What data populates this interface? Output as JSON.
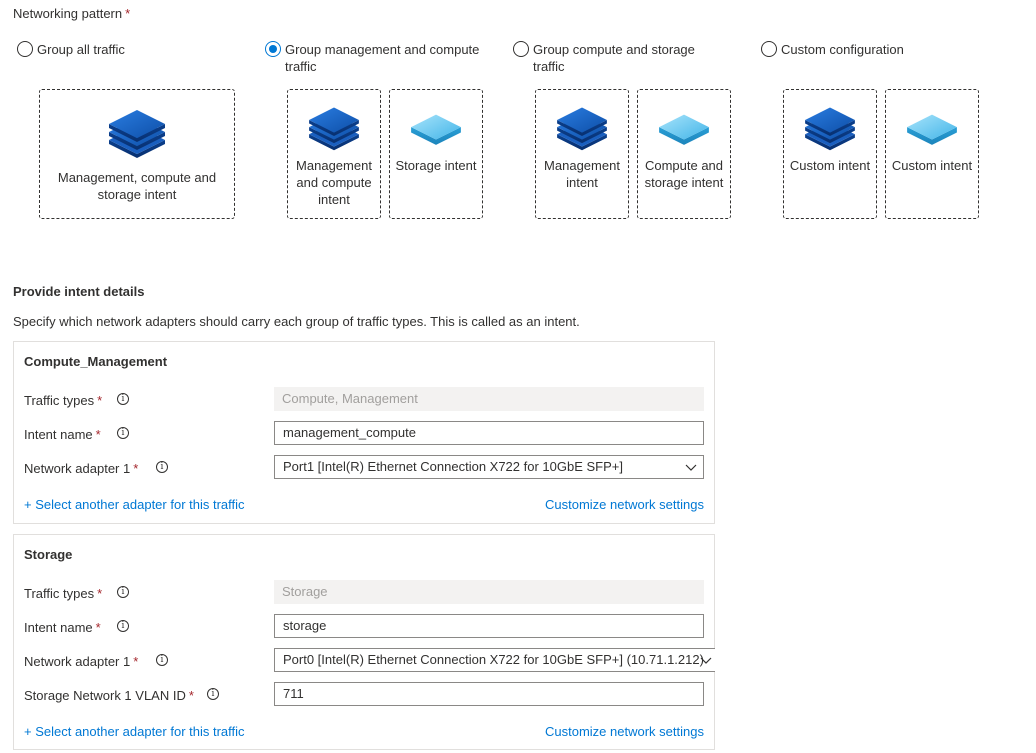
{
  "networking_pattern": {
    "label": "Networking pattern",
    "required_marker": "*",
    "options": [
      {
        "label": "Group all traffic",
        "selected": false
      },
      {
        "label": "Group management and compute traffic",
        "selected": true
      },
      {
        "label": "Group compute and storage traffic",
        "selected": false
      },
      {
        "label": "Custom configuration",
        "selected": false
      }
    ],
    "cards": {
      "group_all": [
        "Management, compute and storage intent"
      ],
      "group_mgmt_compute": [
        "Management and compute intent",
        "Storage intent"
      ],
      "group_compute_storage": [
        "Management intent",
        "Compute and storage intent"
      ],
      "custom": [
        "Custom intent",
        "Custom intent"
      ]
    },
    "icon_colors": {
      "dark_blue": "#1565c0",
      "light_blue": "#5fc3ee"
    }
  },
  "intent_details": {
    "heading": "Provide intent details",
    "description": "Specify which network adapters should carry each group of traffic types. This is called as an intent.",
    "sections": [
      {
        "title": "Compute_Management",
        "traffic_types_label": "Traffic types",
        "traffic_types_value": "Compute, Management",
        "intent_name_label": "Intent name",
        "intent_name_value": "management_compute",
        "adapter_label": "Network adapter 1",
        "adapter_value": "Port1 [Intel(R) Ethernet Connection X722 for 10GbE SFP+]",
        "add_adapter_link": "+ Select another adapter for this traffic",
        "customize_link": "Customize network settings"
      },
      {
        "title": "Storage",
        "traffic_types_label": "Traffic types",
        "traffic_types_value": "Storage",
        "intent_name_label": "Intent name",
        "intent_name_value": "storage",
        "adapter_label": "Network adapter 1",
        "adapter_value": "Port0 [Intel(R) Ethernet Connection X722 for 10GbE SFP+] (10.71.1.212)",
        "vlan_label": "Storage Network 1 VLAN ID",
        "vlan_value": "711",
        "add_adapter_link": "+ Select another adapter for this traffic",
        "customize_link": "Customize network settings"
      }
    ],
    "required_marker": "*",
    "info_glyph": "i"
  },
  "colors": {
    "accent": "#0078d4",
    "required": "#a4262c"
  }
}
